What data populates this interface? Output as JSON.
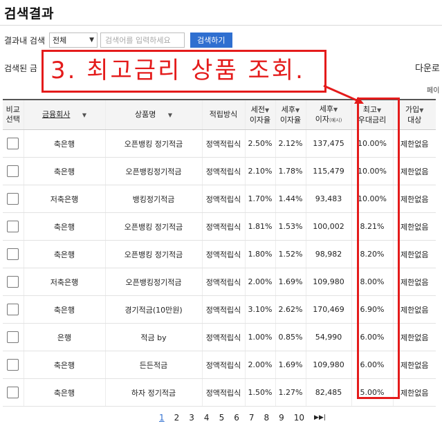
{
  "page_title": "검색결과",
  "search": {
    "label": "결과내 검색",
    "scope_value": "전체",
    "placeholder": "검색어를 입력하세요",
    "button_label": "검색하기"
  },
  "result_count_label": "검색된 금",
  "download_label": "다운로",
  "page_per_label": "페이",
  "annotation_text": "3. 최고금리 상품 조회.",
  "table": {
    "headers": {
      "compare": [
        "비교",
        "선택"
      ],
      "bank": "금융회사",
      "product": "상품명",
      "method": "적립방식",
      "pre_tax_rate": [
        "세전",
        "이자율"
      ],
      "post_tax_rate": [
        "세후",
        "이자율"
      ],
      "post_tax_interest": [
        "세후",
        "이자",
        "(예시)"
      ],
      "max_rate": [
        "최고",
        "우대금리"
      ],
      "eligibility": [
        "가입",
        "대상"
      ]
    },
    "rows": [
      {
        "bank": "축은행",
        "product": "오픈뱅킹 정기적금",
        "method": "정액적립식",
        "pre_tax": "2.50%",
        "post_tax": "2.12%",
        "interest": "137,475",
        "max_rate": "10.00%",
        "eligibility": "제한없음"
      },
      {
        "bank": "축은행",
        "product": "오픈뱅킹정기적금",
        "method": "정액적립식",
        "pre_tax": "2.10%",
        "post_tax": "1.78%",
        "interest": "115,479",
        "max_rate": "10.00%",
        "eligibility": "제한없음"
      },
      {
        "bank": "저축은행",
        "product": "뱅킹정기적금",
        "method": "정액적립식",
        "pre_tax": "1.70%",
        "post_tax": "1.44%",
        "interest": "93,483",
        "max_rate": "10.00%",
        "eligibility": "제한없음"
      },
      {
        "bank": "축은행",
        "product": "오픈뱅킹 정기적금",
        "method": "정액적립식",
        "pre_tax": "1.81%",
        "post_tax": "1.53%",
        "interest": "100,002",
        "max_rate": "8.21%",
        "eligibility": "제한없음"
      },
      {
        "bank": "축은행",
        "product": "오픈뱅킹 정기적금",
        "method": "정액적립식",
        "pre_tax": "1.80%",
        "post_tax": "1.52%",
        "interest": "98,982",
        "max_rate": "8.20%",
        "eligibility": "제한없음"
      },
      {
        "bank": "저축은행",
        "product": "오픈뱅킹정기적금",
        "method": "정액적립식",
        "pre_tax": "2.00%",
        "post_tax": "1.69%",
        "interest": "109,980",
        "max_rate": "8.00%",
        "eligibility": "제한없음"
      },
      {
        "bank": "축은행",
        "product": "경기적금(10만원)",
        "method": "정액적립식",
        "pre_tax": "3.10%",
        "post_tax": "2.62%",
        "interest": "170,469",
        "max_rate": "6.90%",
        "eligibility": "제한없음"
      },
      {
        "bank": "은행",
        "product": "적금 by",
        "method": "정액적립식",
        "pre_tax": "1.00%",
        "post_tax": "0.85%",
        "interest": "54,990",
        "max_rate": "6.00%",
        "eligibility": "제한없음"
      },
      {
        "bank": "축은행",
        "product": "든든적금",
        "method": "정액적립식",
        "pre_tax": "2.00%",
        "post_tax": "1.69%",
        "interest": "109,980",
        "max_rate": "6.00%",
        "eligibility": "제한없음"
      },
      {
        "bank": "축은행",
        "product": "하자 정기적금",
        "method": "정액적립식",
        "pre_tax": "1.50%",
        "post_tax": "1.27%",
        "interest": "82,485",
        "max_rate": "5.00%",
        "eligibility": "제한없음"
      }
    ]
  },
  "pagination": {
    "pages": [
      "1",
      "2",
      "3",
      "4",
      "5",
      "6",
      "7",
      "8",
      "9",
      "10"
    ],
    "current": "1",
    "next_icon": "▶▶|"
  },
  "colors": {
    "accent": "#2f6fd0",
    "annotation": "#e41b1b"
  },
  "icons": {
    "select_chevron": "chevron-down-icon",
    "sort_toggle": "sort-icon",
    "next_page": "last-page-icon"
  }
}
